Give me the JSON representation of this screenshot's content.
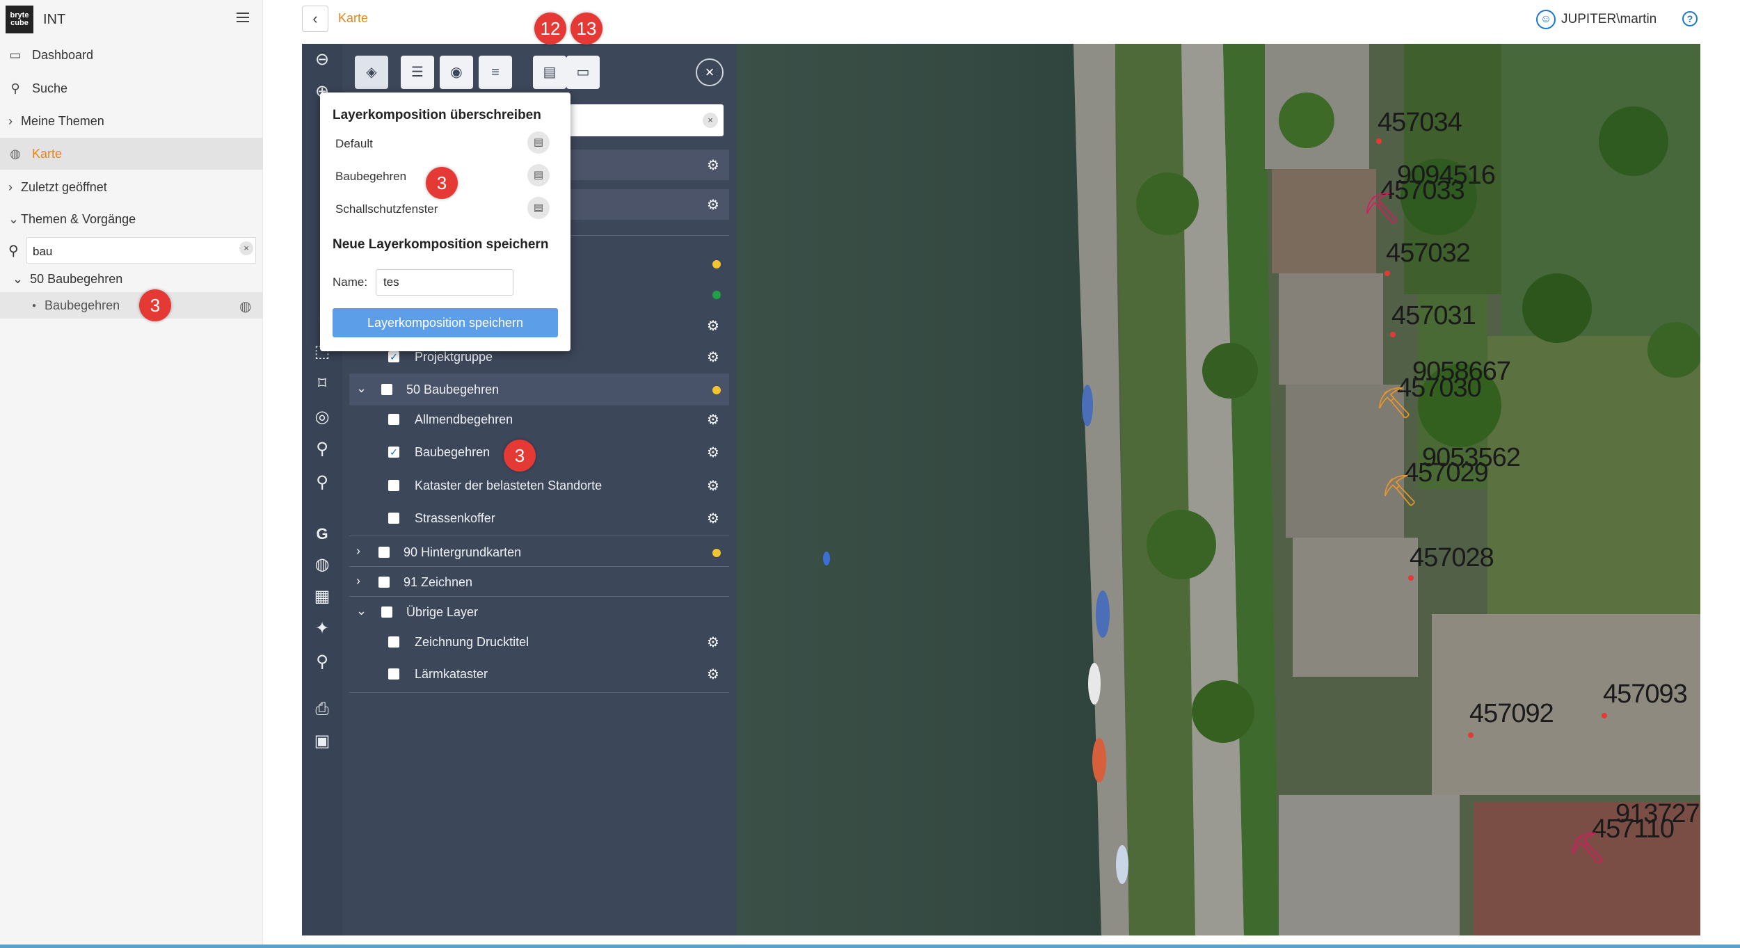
{
  "app": {
    "name": "INT",
    "logo_lines": [
      "bryte",
      "cube"
    ]
  },
  "nav": {
    "dashboard": "Dashboard",
    "search": "Suche",
    "my_topics": "Meine Themen",
    "map": "Karte",
    "recent": "Zuletzt geöffnet",
    "topics": "Themen & Vorgänge"
  },
  "sidebar_search": {
    "value": "bau"
  },
  "tree": {
    "group": "50 Baubegehren",
    "item": "Baubegehren",
    "item_badge": "3"
  },
  "header": {
    "breadcrumb": "Karte",
    "user": "JUPITER\\martin",
    "help": "?"
  },
  "badges": {
    "save_step": "12",
    "open_step": "13"
  },
  "popup": {
    "title_overwrite": "Layerkomposition überschreiben",
    "compositions": [
      "Default",
      "Baubegehren",
      "Schallschutzfenster"
    ],
    "composition_badge": "3",
    "title_new": "Neue Layerkomposition speichern",
    "name_label": "Name:",
    "name_value": "tes",
    "save_button": "Layerkomposition speichern"
  },
  "layers": {
    "projektgruppe": "Projektgruppe",
    "group50": "50 Baubegehren",
    "allmend": "Allmendbegehren",
    "baubegehren": "Baubegehren",
    "baubegehren_badge": "3",
    "kataster": "Kataster der belasteten Standorte",
    "strassen": "Strassenkoffer",
    "group90": "90 Hintergrundkarten",
    "group91": "91 Zeichnen",
    "uebrige": "Übrige Layer",
    "drucktitel": "Zeichnung Drucktitel",
    "laerm": "Lärmkataster"
  },
  "map_labels": [
    "457034",
    "9094516",
    "457033",
    "457032",
    "457031",
    "9058667",
    "457030",
    "9053562",
    "457029",
    "457028",
    "457092",
    "457093",
    "913727",
    "457110"
  ],
  "colors": {
    "accent": "#e8841a",
    "panel": "#3d475a",
    "primary": "#5c9ee8",
    "badge": "#e53935"
  }
}
